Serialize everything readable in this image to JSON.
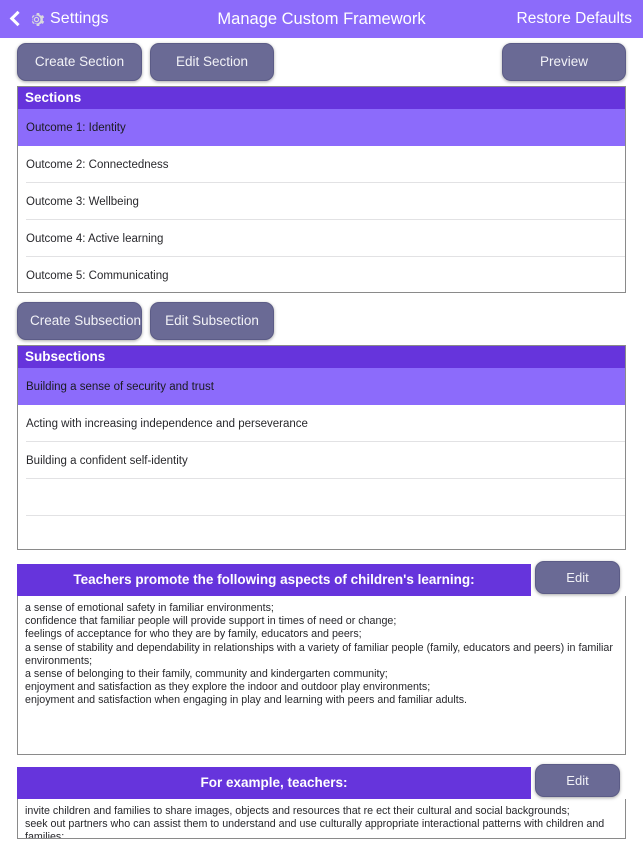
{
  "navbar": {
    "back_label": "Settings",
    "back_icon": "chevron-left-icon",
    "settings_icon": "gear-icon",
    "title": "Manage Custom Framework",
    "right_action": "Restore Defaults",
    "background_color": "#8c6bfa"
  },
  "section_toolbar": {
    "create_label": "Create Section",
    "edit_label": "Edit Section",
    "preview_label": "Preview"
  },
  "sections_panel": {
    "header": "Sections",
    "rows": [
      {
        "label": "Outcome 1: Identity",
        "selected": true
      },
      {
        "label": "Outcome 2: Connectedness",
        "selected": false
      },
      {
        "label": "Outcome 3: Wellbeing",
        "selected": false
      },
      {
        "label": "Outcome 4: Active learning",
        "selected": false
      },
      {
        "label": "Outcome 5: Communicating",
        "selected": false
      }
    ]
  },
  "subsection_toolbar": {
    "create_label": "Create Subsection",
    "edit_label": "Edit Subsection"
  },
  "subsections_panel": {
    "header": "Subsections",
    "rows": [
      {
        "label": "Building a sense of security and trust",
        "selected": true
      },
      {
        "label": "Acting with increasing independence and perseverance",
        "selected": false
      },
      {
        "label": "Building a confident self-identity",
        "selected": false
      },
      {
        "label": "",
        "selected": false
      },
      {
        "label": "",
        "selected": false
      }
    ]
  },
  "promote_block": {
    "header": "Teachers promote the following aspects of children's learning:",
    "edit_label": "Edit",
    "body": "a sense of emotional safety in familiar environments;\nconfidence that familiar people will provide support in times of need or change;\nfeelings of acceptance for who they are by family, educators and peers;\na sense of stability and dependability in relationships with a variety of familiar people (family, educators and peers) in familiar environments;\na sense of belonging to their family, community and kindergarten community;\nenjoyment and satisfaction as they explore the indoor and outdoor play environments;\nenjoyment and satisfaction when engaging in play and learning with peers and familiar adults."
  },
  "example_block": {
    "header": "For example, teachers:",
    "edit_label": "Edit",
    "body": "invite children and families to share images, objects and resources that re ect their cultural and social backgrounds;\nseek out partners who can assist them to understand and use culturally appropriate interactional patterns with children and families;"
  },
  "colors": {
    "nav_purple": "#8c6bfa",
    "header_purple": "#6634dc",
    "selected_row": "#8c6bfb",
    "button_slate": "#6a6a95"
  }
}
